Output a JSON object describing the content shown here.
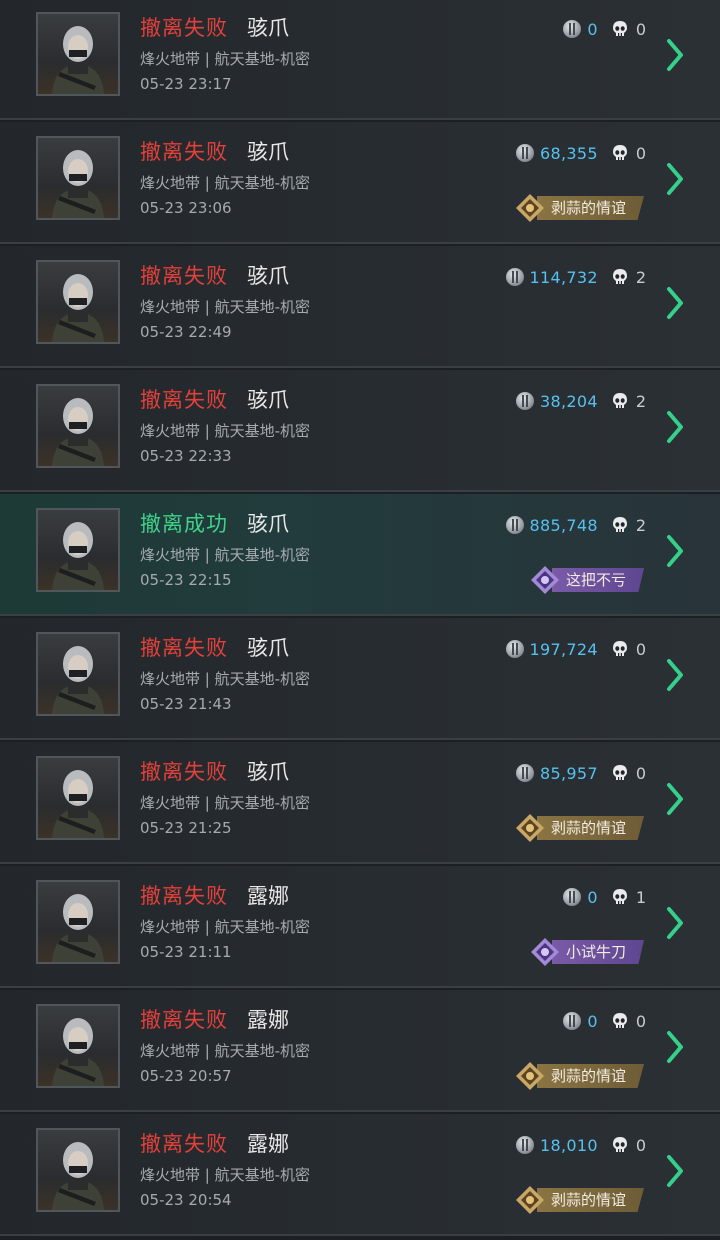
{
  "colors": {
    "fail": "#e2403a",
    "success": "#3fd38a",
    "value": "#56c1f0",
    "chevron": "#35d08a"
  },
  "icons": {
    "currency": "silver-coin-icon",
    "kills": "skull-icon",
    "row_action": "chevron-right-icon",
    "badge_gold": "gold-emblem-icon",
    "badge_purple": "purple-emblem-icon"
  },
  "matches": [
    {
      "status": "撤离失败",
      "result": "fail",
      "operator": "骇爪",
      "map": "烽火地带 | 航天基地-机密",
      "time": "05-23 23:17",
      "value": "0",
      "kills": "0",
      "badge": null,
      "badge_type": null
    },
    {
      "status": "撤离失败",
      "result": "fail",
      "operator": "骇爪",
      "map": "烽火地带 | 航天基地-机密",
      "time": "05-23 23:06",
      "value": "68,355",
      "kills": "0",
      "badge": "剥蒜的情谊",
      "badge_type": "gold"
    },
    {
      "status": "撤离失败",
      "result": "fail",
      "operator": "骇爪",
      "map": "烽火地带 | 航天基地-机密",
      "time": "05-23 22:49",
      "value": "114,732",
      "kills": "2",
      "badge": null,
      "badge_type": null
    },
    {
      "status": "撤离失败",
      "result": "fail",
      "operator": "骇爪",
      "map": "烽火地带 | 航天基地-机密",
      "time": "05-23 22:33",
      "value": "38,204",
      "kills": "2",
      "badge": null,
      "badge_type": null
    },
    {
      "status": "撤离成功",
      "result": "success",
      "operator": "骇爪",
      "map": "烽火地带 | 航天基地-机密",
      "time": "05-23 22:15",
      "value": "885,748",
      "kills": "2",
      "badge": "这把不亏",
      "badge_type": "purple"
    },
    {
      "status": "撤离失败",
      "result": "fail",
      "operator": "骇爪",
      "map": "烽火地带 | 航天基地-机密",
      "time": "05-23 21:43",
      "value": "197,724",
      "kills": "0",
      "badge": null,
      "badge_type": null
    },
    {
      "status": "撤离失败",
      "result": "fail",
      "operator": "骇爪",
      "map": "烽火地带 | 航天基地-机密",
      "time": "05-23 21:25",
      "value": "85,957",
      "kills": "0",
      "badge": "剥蒜的情谊",
      "badge_type": "gold"
    },
    {
      "status": "撤离失败",
      "result": "fail",
      "operator": "露娜",
      "map": "烽火地带 | 航天基地-机密",
      "time": "05-23 21:11",
      "value": "0",
      "kills": "1",
      "badge": "小试牛刀",
      "badge_type": "purple"
    },
    {
      "status": "撤离失败",
      "result": "fail",
      "operator": "露娜",
      "map": "烽火地带 | 航天基地-机密",
      "time": "05-23 20:57",
      "value": "0",
      "kills": "0",
      "badge": "剥蒜的情谊",
      "badge_type": "gold"
    },
    {
      "status": "撤离失败",
      "result": "fail",
      "operator": "露娜",
      "map": "烽火地带 | 航天基地-机密",
      "time": "05-23 20:54",
      "value": "18,010",
      "kills": "0",
      "badge": "剥蒜的情谊",
      "badge_type": "gold"
    }
  ]
}
